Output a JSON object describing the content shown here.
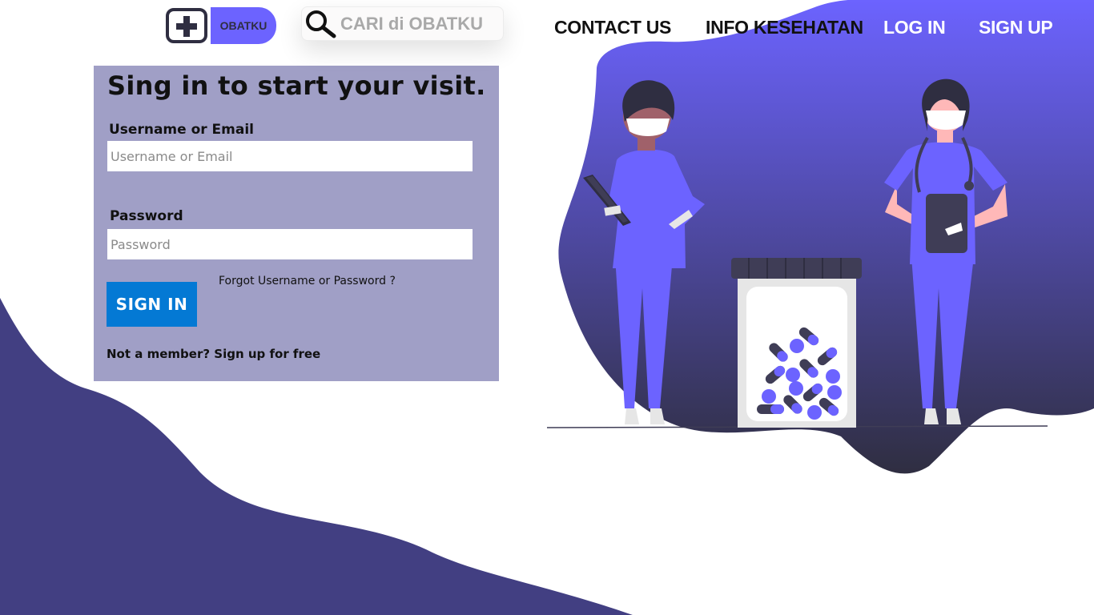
{
  "header": {
    "logo_text": "OBATKU",
    "search": {
      "placeholder": "CARI di OBATKU",
      "value": ""
    },
    "nav": {
      "contact": "CONTACT US",
      "info": "INFO KESEHATAN",
      "login": "LOG IN",
      "signup": "SIGN UP"
    }
  },
  "login": {
    "title": "Sing in to start your visit.",
    "username_label": "Username or Email",
    "username_placeholder": "Username or Email",
    "password_label": "Password",
    "password_placeholder": "Password",
    "forgot_text": "Forgot Username or Password ?",
    "signin_label": "SIGN IN",
    "signup_text": "Not a member? Sign up for free"
  },
  "colors": {
    "brand_purple": "#6c63ff",
    "dark_navy": "#2f2e41",
    "wave_purple": "#423f82",
    "panel_bg": "#a09fc6",
    "button_blue": "#0479d4"
  }
}
